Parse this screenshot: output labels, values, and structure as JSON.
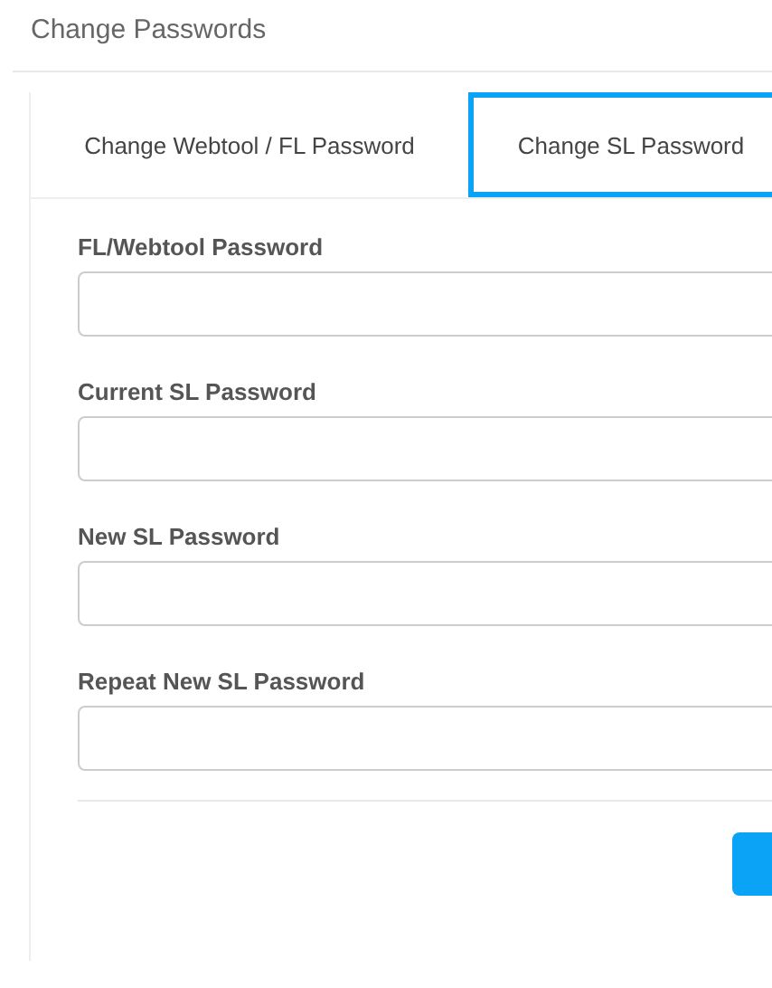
{
  "page": {
    "title": "Change Passwords"
  },
  "tabs": [
    {
      "label": "Change Webtool / FL Password",
      "selected": false
    },
    {
      "label": "Change SL Password",
      "selected": true
    }
  ],
  "fields": [
    {
      "label": "FL/Webtool Password"
    },
    {
      "label": "Current SL Password"
    },
    {
      "label": "New SL Password"
    },
    {
      "label": "Repeat New SL Password"
    }
  ]
}
